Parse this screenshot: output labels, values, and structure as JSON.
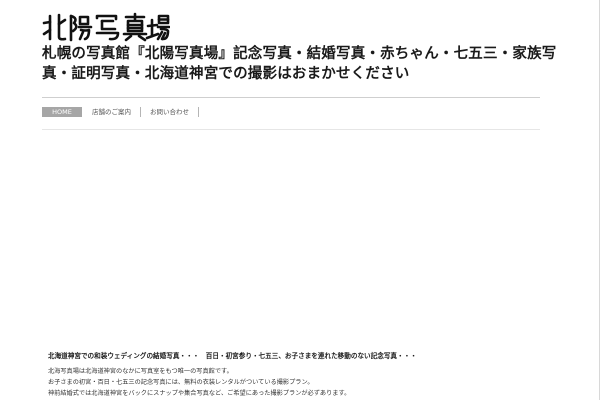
{
  "site": {
    "logo_text": "北陽写真場",
    "headline": "札幌の写真館『北陽写真場』記念写真・結婚写真・赤ちゃん・七五三・家族写真・証明写真・北海道神宮での撮影はおまかせください"
  },
  "nav": {
    "items": [
      {
        "label": "HOME",
        "active": true
      },
      {
        "label": "店舗のご案内",
        "active": false
      },
      {
        "label": "お問い合わせ",
        "active": false
      }
    ]
  },
  "intro": {
    "title": "北海道神宮での和装ウェディングの結婚写真・・・　百日・初宮参り・七五三、お子さまを連れた移動のない記念写真・・・",
    "lines": [
      "北海写真場は北海道神宮のなかに写真室をもつ唯一の写真館です。",
      "お子さまの初宮・百日・七五三の記念写真には、無料の衣装レンタルがついている撮影プラン。",
      "神前結婚式では北海道神宮をバックにスナップや集合写真など、ご希望にあった撮影プランが必ずあります。"
    ]
  },
  "colors": {
    "nav_active_bg": "#a6a6a6",
    "rule": "#cfcfcf",
    "text": "#222222"
  }
}
